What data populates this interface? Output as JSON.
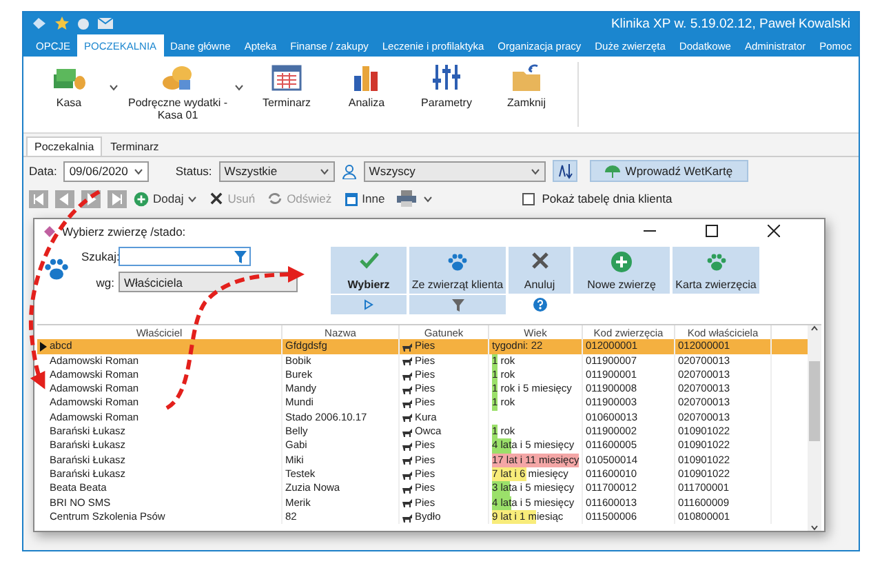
{
  "window": {
    "title": "Klinika XP w. 5.19.02.12, Paweł Kowalski"
  },
  "menu": [
    {
      "label": "OPCJE",
      "selected": false
    },
    {
      "label": "POCZEKALNIA",
      "selected": true
    },
    {
      "label": "Dane główne",
      "selected": false
    },
    {
      "label": "Apteka",
      "selected": false
    },
    {
      "label": "Finanse / zakupy",
      "selected": false
    },
    {
      "label": "Leczenie i profilaktyka",
      "selected": false
    },
    {
      "label": "Organizacja pracy",
      "selected": false
    },
    {
      "label": "Duże zwierzęta",
      "selected": false
    },
    {
      "label": "Dodatkowe",
      "selected": false
    },
    {
      "label": "Administrator",
      "selected": false
    },
    {
      "label": "Pomoc",
      "selected": false
    }
  ],
  "ribbon": [
    {
      "label": "Kasa",
      "dropdown": true
    },
    {
      "label": "Podręczne wydatki - Kasa 01",
      "dropdown": true
    },
    {
      "label": "Terminarz",
      "dropdown": false
    },
    {
      "label": "Analiza",
      "dropdown": false
    },
    {
      "label": "Parametry",
      "dropdown": false
    },
    {
      "label": "Zamknij",
      "dropdown": false
    }
  ],
  "tabs": [
    {
      "label": "Poczekalnia",
      "selected": true
    },
    {
      "label": "Terminarz",
      "selected": false
    }
  ],
  "filters": {
    "date_label": "Data:",
    "date": "09/06/2020",
    "status_label": "Status:",
    "status": "Wszystkie",
    "person": "Wszyscy",
    "wetkarta_button": "Wprowadź WetKartę"
  },
  "actions": [
    {
      "label": "Dodaj",
      "disabled": false,
      "dropdown": true
    },
    {
      "label": "Usuń",
      "disabled": true,
      "dropdown": false
    },
    {
      "label": "Odśwież",
      "disabled": true,
      "dropdown": false
    },
    {
      "label": "Inne",
      "disabled": false,
      "dropdown": false
    }
  ],
  "show_table": {
    "label": "Pokaż tabelę dnia klienta",
    "checked": false
  },
  "dialog": {
    "title": "Wybierz zwierzę /stado:",
    "search_label": "Szukaj:",
    "by_label": "wg:",
    "by_value": "Właściciela",
    "buttons": [
      {
        "label": "Wybierz",
        "primary": true
      },
      {
        "label": "Ze zwierząt klienta",
        "primary": false
      },
      {
        "label": "Anuluj",
        "primary": false
      },
      {
        "label": "Nowe zwierzę",
        "primary": false
      },
      {
        "label": "Karta zwierzęcia",
        "primary": false
      }
    ],
    "columns": [
      "Właściciel",
      "Nazwa",
      "Gatunek",
      "Wiek",
      "Kod zwierzęcia",
      "Kod właściciela"
    ],
    "rows": [
      {
        "owner": "abcd",
        "name": "Gfdgdsfg",
        "species": "Pies",
        "age": "tygodni: 22",
        "animal_code": "012000001",
        "owner_code": "012000001",
        "selected": true
      },
      {
        "owner": "Adamowski Roman",
        "name": "Bobik",
        "species": "Pies",
        "age": "1 rok",
        "age_bar": {
          "level": 0.06,
          "color": "#9be06a"
        },
        "animal_code": "011900007",
        "owner_code": "020700013",
        "selected": false
      },
      {
        "owner": "Adamowski Roman",
        "name": "Burek",
        "species": "Pies",
        "age": "1 rok",
        "age_bar": {
          "level": 0.06,
          "color": "#9be06a"
        },
        "animal_code": "011900001",
        "owner_code": "020700013",
        "selected": false
      },
      {
        "owner": "Adamowski Roman",
        "name": "Mandy",
        "species": "Pies",
        "age": "1 rok i 5 miesięcy",
        "age_bar": {
          "level": 0.06,
          "color": "#9be06a"
        },
        "animal_code": "011900008",
        "owner_code": "020700013",
        "selected": false
      },
      {
        "owner": "Adamowski Roman",
        "name": "Mundi",
        "species": "Pies",
        "age": "1 rok",
        "age_bar": {
          "level": 0.06,
          "color": "#9be06a"
        },
        "animal_code": "011900003",
        "owner_code": "020700013",
        "selected": false
      },
      {
        "owner": "Adamowski Roman",
        "name": "Stado 2006.10.17",
        "species": "Kura",
        "age": "",
        "animal_code": "010600013",
        "owner_code": "020700013",
        "selected": false
      },
      {
        "owner": "Barański Łukasz",
        "name": "Belly",
        "species": "Owca",
        "age": "1 rok",
        "age_bar": {
          "level": 0.06,
          "color": "#9be06a"
        },
        "animal_code": "011900002",
        "owner_code": "010901022",
        "selected": false
      },
      {
        "owner": "Barański Łukasz",
        "name": "Gabi",
        "species": "Pies",
        "age": "4 lata i 5 miesięcy",
        "age_bar": {
          "level": 0.22,
          "color": "#9be06a"
        },
        "animal_code": "011600005",
        "owner_code": "010901022",
        "selected": false
      },
      {
        "owner": "Barański Łukasz",
        "name": "Miki",
        "species": "Pies",
        "age": "17 lat i 11 miesięcy",
        "age_bar": {
          "level": 1,
          "color": "#f4a6a6"
        },
        "animal_code": "010500014",
        "owner_code": "010901022",
        "selected": false
      },
      {
        "owner": "Barański Łukasz",
        "name": "Testek",
        "species": "Pies",
        "age": "7 lat i 6 miesięcy",
        "age_bar": {
          "level": 0.4,
          "color": "#f8ec7a"
        },
        "animal_code": "011600010",
        "owner_code": "010901022",
        "selected": false
      },
      {
        "owner": "Beata Beata",
        "name": "Zuzia Nowa",
        "species": "Pies",
        "age": "3 lata i 5 miesięcy",
        "age_bar": {
          "level": 0.2,
          "color": "#9be06a"
        },
        "animal_code": "011700012",
        "owner_code": "011700001",
        "selected": false
      },
      {
        "owner": "BRI NO SMS",
        "name": "Merik",
        "species": "Pies",
        "age": "4 lata i 5 miesięcy",
        "age_bar": {
          "level": 0.22,
          "color": "#9be06a"
        },
        "animal_code": "011600013",
        "owner_code": "011600009",
        "selected": false
      },
      {
        "owner": "Centrum Szkolenia Psów",
        "name": "82",
        "species": "Bydło",
        "age": "9 lat i 1 miesiąc",
        "age_bar": {
          "level": 0.5,
          "color": "#f8ec7a"
        },
        "animal_code": "011500006",
        "owner_code": "010800001",
        "selected": false
      }
    ]
  }
}
